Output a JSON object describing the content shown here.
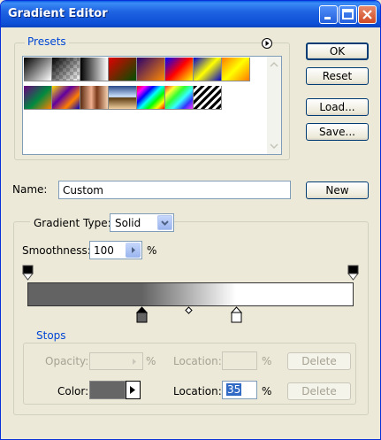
{
  "window": {
    "title": "Gradient Editor"
  },
  "presets": {
    "legend": "Presets",
    "swatches": [
      {
        "name": "foreground-to-background",
        "bg": "linear-gradient(135deg,#000 0%,#fff 100%)"
      },
      {
        "name": "foreground-to-transparent",
        "bg": "linear-gradient(135deg,#000 0%,rgba(0,0,0,0) 100%),repeating-conic-gradient(#ccc 0% 25%,#fff 0% 50%) 0 0/8px 8px"
      },
      {
        "name": "black-white",
        "bg": "linear-gradient(90deg,#000 0%,#fff 100%)"
      },
      {
        "name": "red-green",
        "bg": "linear-gradient(135deg,#e00000 0%,#005000 100%)"
      },
      {
        "name": "violet-orange",
        "bg": "linear-gradient(135deg,#2a0070 0%,#ff8a00 100%)"
      },
      {
        "name": "blue-red-yellow",
        "bg": "linear-gradient(135deg,#0000ff 0%,#ff0000 50%,#ffff00 100%)"
      },
      {
        "name": "blue-yellow-blue",
        "bg": "linear-gradient(135deg,#0000d0 0%,#ffff00 50%,#0000d0 100%)"
      },
      {
        "name": "orange-yellow-orange",
        "bg": "linear-gradient(135deg,#ff7a00 0%,#ffff00 50%,#ff7a00 100%)"
      },
      {
        "name": "violet-green-orange",
        "bg": "linear-gradient(135deg,#6a0080 0%,#008a40 55%,#ff8000 100%)"
      },
      {
        "name": "yellow-violet-orange-blue",
        "bg": "linear-gradient(135deg,#ffe000 0%,#6000a0 40%,#ff8000 70%,#0000c0 100%)"
      },
      {
        "name": "copper",
        "bg": "linear-gradient(90deg,#5a2a10 0%,#f0b090 40%,#7a3a1a 60%,#f6d0b0 100%)"
      },
      {
        "name": "chrome",
        "bg": "linear-gradient(180deg,#2a4a8a 0%,#cfe6ff 48%,#5a3a10 52%,#f0d0a0 100%)"
      },
      {
        "name": "spectrum",
        "bg": "linear-gradient(135deg,#ff0000,#ff00ff,#0000ff,#00ffff,#00ff00,#ffff00,#ff0000)"
      },
      {
        "name": "transparent-rainbow",
        "bg": "linear-gradient(135deg,rgba(255,0,0,.8),rgba(255,255,0,.8),rgba(0,255,0,.8),rgba(0,255,255,.8),rgba(0,0,255,.8),rgba(255,0,255,.8)),#fff"
      },
      {
        "name": "transparent-stripes",
        "bg": "repeating-linear-gradient(135deg,#000 0px,#000 3px,#fff 3px,#fff 6px)"
      }
    ]
  },
  "buttons": {
    "ok": "OK",
    "reset": "Reset",
    "load": "Load...",
    "save": "Save...",
    "new": "New"
  },
  "name_field": {
    "label": "Name:",
    "value": "Custom"
  },
  "gradient_type": {
    "label": "Gradient Type:",
    "value": "Solid"
  },
  "smoothness": {
    "label": "Smoothness:",
    "value": "100",
    "unit": "%"
  },
  "gradient": {
    "css": "linear-gradient(90deg,#636363 0%,#636363 35%,#ffffff 64%,#ffffff 100%)",
    "color_stops": [
      {
        "location": 35,
        "color": "#636363"
      },
      {
        "location": 64,
        "color": "#ffffff"
      }
    ],
    "midpoint": 50
  },
  "stops": {
    "legend": "Stops",
    "opacity_label": "Opacity:",
    "opacity_unit": "%",
    "location_label_top": "Location:",
    "location_unit_top": "%",
    "delete_label": "Delete",
    "color_label": "Color:",
    "color_value": "#666666",
    "location_label": "Location:",
    "location_value": "35",
    "location_unit": "%",
    "delete_label_2": "Delete"
  }
}
